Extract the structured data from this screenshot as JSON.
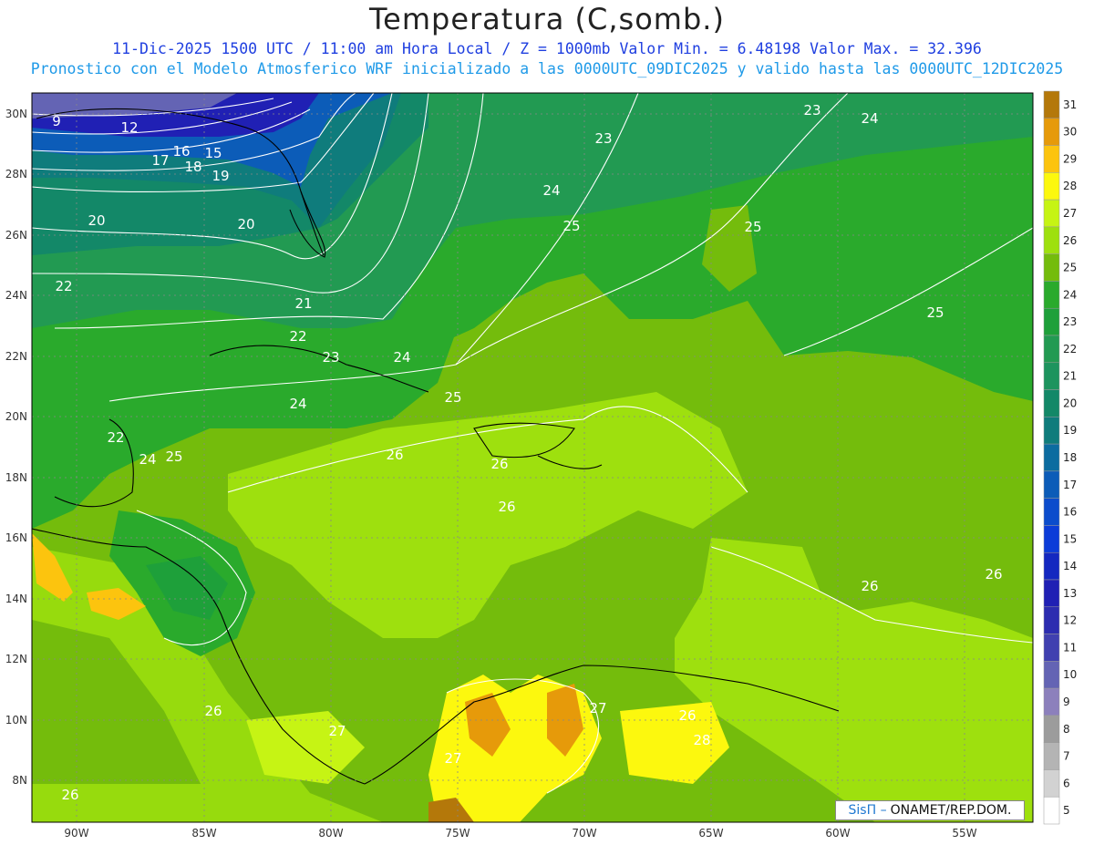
{
  "header": {
    "title": "Temperatura (C,somb.)",
    "subtitle_1": "11-Dic-2025 1500 UTC / 11:00 am Hora Local / Z = 1000mb   Valor Min. = 6.48198  Valor Max. = 32.396",
    "subtitle_2": "Pronostico con el Modelo Atmosferico WRF inicializado a las 0000UTC_09DIC2025 y valido hasta las  0000UTC_12DIC2025"
  },
  "map": {
    "lon_labels": [
      "90W",
      "85W",
      "80W",
      "75W",
      "70W",
      "65W",
      "60W",
      "55W"
    ],
    "lat_labels": [
      "30N",
      "28N",
      "26N",
      "24N",
      "22N",
      "20N",
      "18N",
      "16N",
      "14N",
      "12N",
      "10N",
      "8N"
    ],
    "contour_labels": [
      "9",
      "12",
      "15",
      "16",
      "17",
      "18",
      "19",
      "20",
      "20",
      "21",
      "22",
      "22",
      "22",
      "23",
      "23",
      "23",
      "24",
      "24",
      "24",
      "24",
      "24",
      "25",
      "25",
      "25",
      "25",
      "25",
      "26",
      "26",
      "26",
      "26",
      "26",
      "26",
      "26",
      "26",
      "27",
      "27",
      "27",
      "28"
    ]
  },
  "legend": {
    "levels": [
      "31",
      "30",
      "29",
      "28",
      "27",
      "26",
      "25",
      "24",
      "23",
      "22",
      "21",
      "20",
      "19",
      "18",
      "17",
      "16",
      "15",
      "14",
      "13",
      "12",
      "11",
      "10",
      "9",
      "8",
      "7",
      "6",
      "5"
    ],
    "colors": [
      "#b4780a",
      "#e69a0a",
      "#fcc40e",
      "#fcf80e",
      "#c6f414",
      "#9ee00e",
      "#74bc0c",
      "#2aaa2c",
      "#1ea03a",
      "#229a52",
      "#1d945e",
      "#138868",
      "#0f7c7c",
      "#0c6ca0",
      "#0c5cb8",
      "#0c4ccc",
      "#0c3cd8",
      "#1428c0",
      "#2020b4",
      "#2c2cb0",
      "#4040b0",
      "#6464b4",
      "#8c80bc",
      "#9c9c9c",
      "#b4b4b4",
      "#d2d2d2",
      "#ffffff"
    ]
  },
  "credit": {
    "brand": "SisΠ –",
    "org": "ONAMET/REP.DOM."
  }
}
